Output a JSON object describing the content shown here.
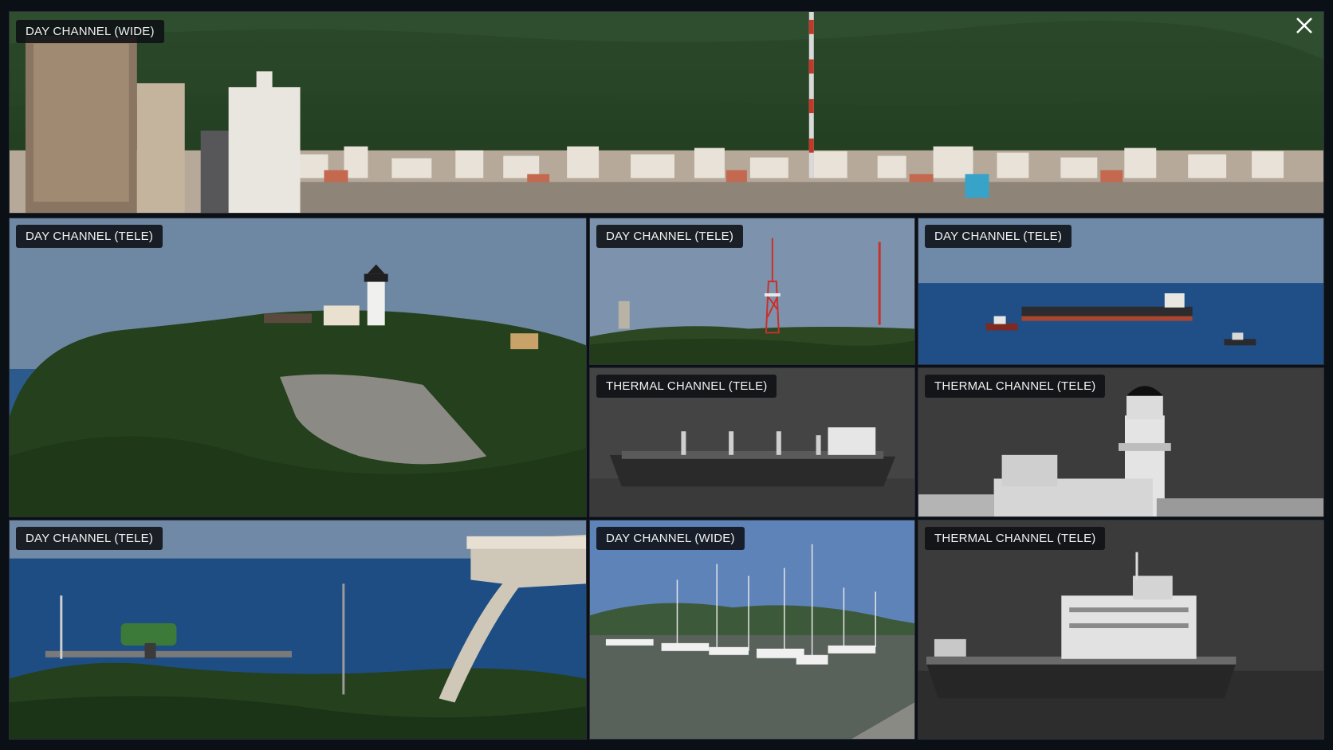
{
  "tiles": [
    {
      "id": "top-wide",
      "label": "DAY CHANNEL (WIDE)",
      "channel": "day",
      "lens": "wide",
      "scene": "hillside-city-with-tower"
    },
    {
      "id": "cliff-lighthouse",
      "label": "DAY CHANNEL (TELE)",
      "channel": "day",
      "lens": "tele",
      "scene": "forested-cliff-with-lighthouse"
    },
    {
      "id": "red-tower",
      "label": "DAY CHANNEL (TELE)",
      "channel": "day",
      "lens": "tele",
      "scene": "red-lattice-tower-on-treeline"
    },
    {
      "id": "sea-ships",
      "label": "DAY CHANNEL (TELE)",
      "channel": "day",
      "lens": "tele",
      "scene": "cargo-ship-and-tugs-at-sea"
    },
    {
      "id": "thermal-ship",
      "label": "THERMAL CHANNEL (TELE)",
      "channel": "thermal",
      "lens": "tele",
      "scene": "cargo-ship-thermal"
    },
    {
      "id": "thermal-lighthouse",
      "label": "THERMAL CHANNEL (TELE)",
      "channel": "thermal",
      "lens": "tele",
      "scene": "lighthouse-thermal"
    },
    {
      "id": "radar-coast",
      "label": "DAY CHANNEL (TELE)",
      "channel": "day",
      "lens": "tele",
      "scene": "coastal-radar-station"
    },
    {
      "id": "marina",
      "label": "DAY CHANNEL (WIDE)",
      "channel": "day",
      "lens": "wide",
      "scene": "marina-with-sailboats"
    },
    {
      "id": "thermal-ship-close",
      "label": "THERMAL CHANNEL (TELE)",
      "channel": "thermal",
      "lens": "tele",
      "scene": "ship-superstructure-thermal"
    }
  ],
  "close_button": {
    "symbol": "X",
    "icon": "close-icon"
  },
  "colors": {
    "background": "#0b0f16",
    "label_bg": "#0e1014",
    "label_text": "#f2f2f2",
    "sky_day": "#6b84a3",
    "sea_day": "#1f4f86",
    "forest": "#26401f",
    "thermal_bg": "#3a3a3a"
  }
}
